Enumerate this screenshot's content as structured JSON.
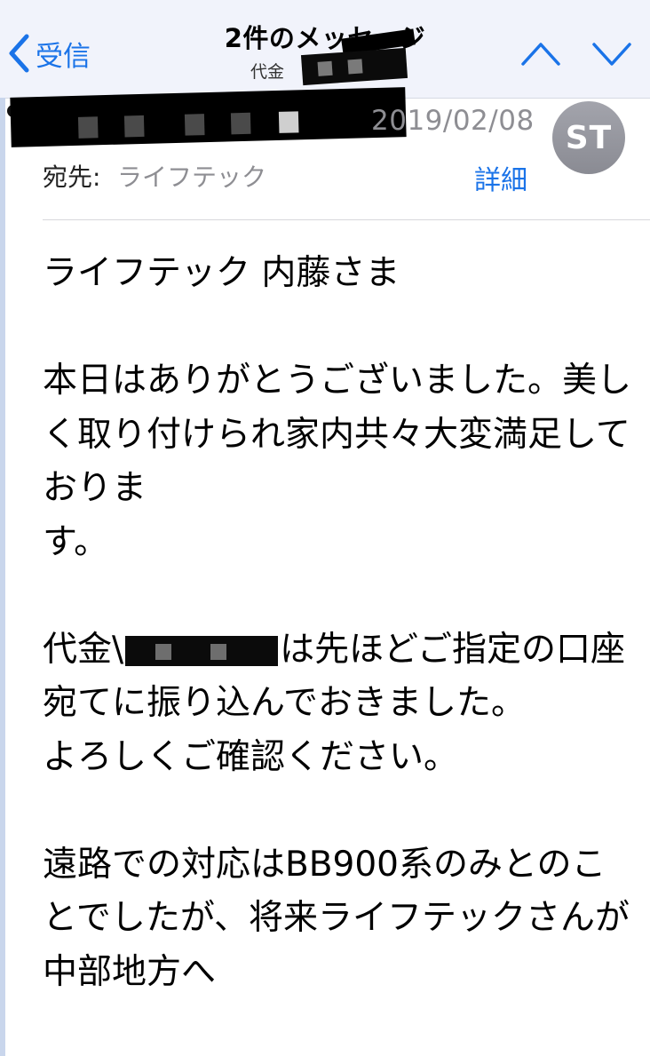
{
  "navbar": {
    "back_label": "受信",
    "title": "2件のメッセージ",
    "subtitle_prefix": "代金"
  },
  "header": {
    "date": "2019/02/08",
    "avatar_initials": "ST",
    "to_label": "宛先:",
    "to_value": "ライフテック",
    "details_label": "詳細"
  },
  "body": {
    "greeting": "ライフテック 内藤さま",
    "para1": "本日はありがとうございました。美しく取り付けられ家内共々大変満足しておりま\nす。",
    "para2_prefix": "代金\\",
    "para2_suffix": "は先ほどご指定の口座宛てに振り込んでおきました。\nよろしくご確認ください。",
    "para3": "遠路での対応はBB900系のみとのことでしたが、将来ライフテックさんが中部地方へ"
  },
  "colors": {
    "accent": "#1a73e8",
    "navbar_bg": "#f1f3fb",
    "secondary_text": "#8e8e93",
    "avatar_bg": "#98999f"
  },
  "icons": {
    "back": "chevron-left-icon",
    "up": "chevron-up-icon",
    "down": "chevron-down-icon"
  }
}
